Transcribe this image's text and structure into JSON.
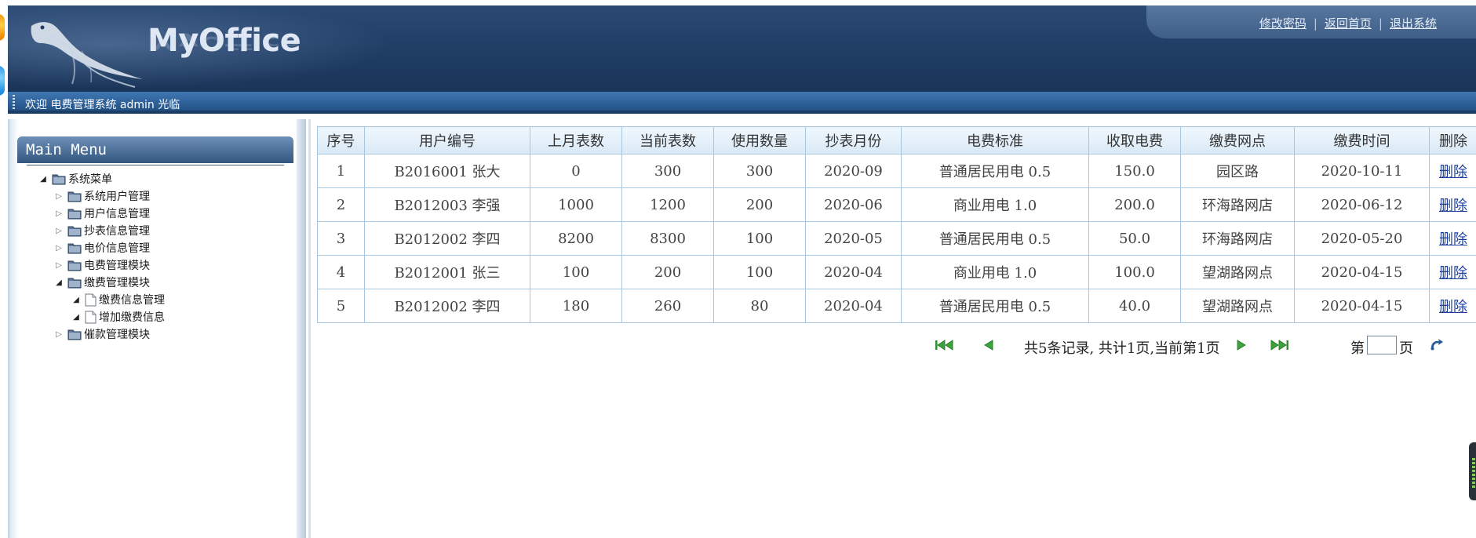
{
  "app": {
    "logo_text": "MyOffice",
    "top_links": [
      "修改密码",
      "返回首页",
      "退出系统"
    ],
    "welcome": "欢迎 电费管理系统 admin 光临"
  },
  "menu": {
    "title": "Main Menu",
    "tree": [
      {
        "label": "系统菜单",
        "level": 0,
        "expanded": true,
        "type": "folder"
      },
      {
        "label": "系统用户管理",
        "level": 1,
        "expanded": false,
        "type": "folder"
      },
      {
        "label": "用户信息管理",
        "level": 1,
        "expanded": false,
        "type": "folder"
      },
      {
        "label": "抄表信息管理",
        "level": 1,
        "expanded": false,
        "type": "folder"
      },
      {
        "label": "电价信息管理",
        "level": 1,
        "expanded": false,
        "type": "folder"
      },
      {
        "label": "电费管理模块",
        "level": 1,
        "expanded": false,
        "type": "folder"
      },
      {
        "label": "缴费管理模块",
        "level": 1,
        "expanded": true,
        "type": "folder"
      },
      {
        "label": "缴费信息管理",
        "level": 2,
        "expanded": true,
        "type": "page"
      },
      {
        "label": "增加缴费信息",
        "level": 2,
        "expanded": true,
        "type": "page"
      },
      {
        "label": "催款管理模块",
        "level": 1,
        "expanded": false,
        "type": "folder"
      }
    ]
  },
  "table": {
    "columns": [
      "序号",
      "用户编号",
      "上月表数",
      "当前表数",
      "使用数量",
      "抄表月份",
      "电费标准",
      "收取电费",
      "缴费网点",
      "缴费时间",
      "删除"
    ],
    "rows": [
      [
        "1",
        "B2016001 张大",
        "0",
        "300",
        "300",
        "2020-09",
        "普通居民用电 0.5",
        "150.0",
        "园区路",
        "2020-10-11",
        "删除"
      ],
      [
        "2",
        "B2012003 李强",
        "1000",
        "1200",
        "200",
        "2020-06",
        "商业用电 1.0",
        "200.0",
        "环海路网店",
        "2020-06-12",
        "删除"
      ],
      [
        "3",
        "B2012002 李四",
        "8200",
        "8300",
        "100",
        "2020-05",
        "普通居民用电 0.5",
        "50.0",
        "环海路网店",
        "2020-05-20",
        "删除"
      ],
      [
        "4",
        "B2012001 张三",
        "100",
        "200",
        "100",
        "2020-04",
        "商业用电 1.0",
        "100.0",
        "望湖路网点",
        "2020-04-15",
        "删除"
      ],
      [
        "5",
        "B2012002 李四",
        "180",
        "260",
        "80",
        "2020-04",
        "普通居民用电 0.5",
        "40.0",
        "望湖路网点",
        "2020-04-15",
        "删除"
      ]
    ]
  },
  "pager": {
    "summary": "共5条记录, 共计1页,当前第1页",
    "page_prefix": "第",
    "page_suffix": "页",
    "page_input_value": ""
  },
  "icons": {
    "first": "first-page-icon",
    "prev": "prev-page-icon",
    "next": "next-page-icon",
    "last": "last-page-icon",
    "go": "go-refresh-icon",
    "folder": "folder-icon",
    "page": "page-icon"
  },
  "colors": {
    "header_bg": "#1f3c63",
    "welcome_bar": "#2f6199",
    "grid_border": "#a9c6e0",
    "link": "#1b3fa0",
    "pager_green": "#3aa53a"
  }
}
